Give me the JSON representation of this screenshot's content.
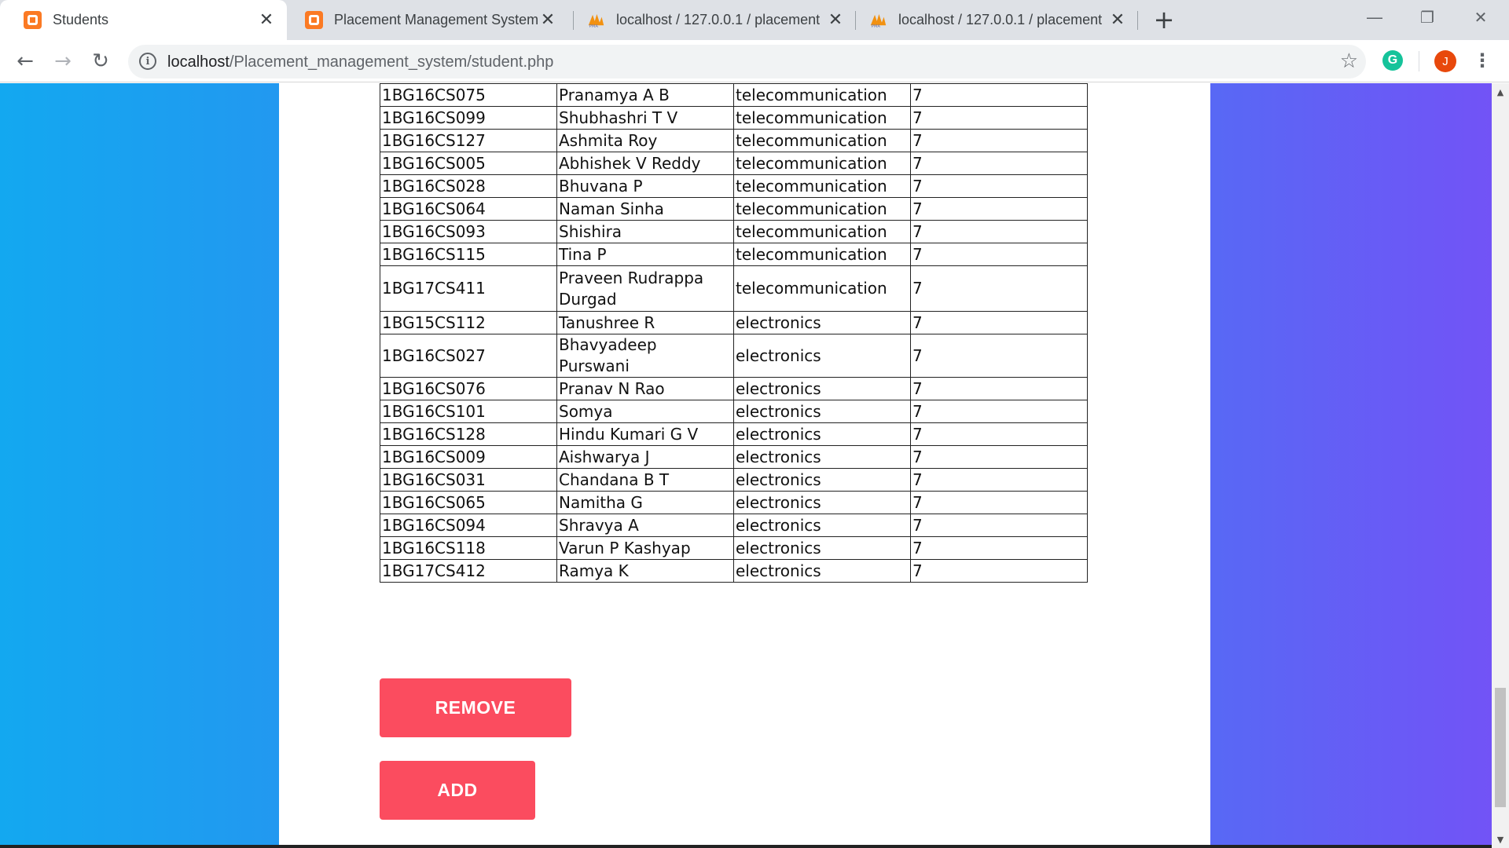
{
  "browser": {
    "tabs": [
      {
        "title": "Students",
        "icon": "xampp-icon",
        "active": true
      },
      {
        "title": "Placement Management System",
        "icon": "xampp-icon",
        "active": false
      },
      {
        "title": "localhost / 127.0.0.1 / placement",
        "icon": "phpmyadmin-icon",
        "active": false
      },
      {
        "title": "localhost / 127.0.0.1 / placement",
        "icon": "phpmyadmin-icon",
        "active": false
      }
    ],
    "url_host": "localhost",
    "url_path": "/Placement_management_system/student.php",
    "avatar_letter": "J",
    "extension_letter": "G"
  },
  "table": {
    "rows": [
      [
        "1BG16CS075",
        "Pranamya A B",
        "telecommunication",
        "7"
      ],
      [
        "1BG16CS099",
        "Shubhashri T V",
        "telecommunication",
        "7"
      ],
      [
        "1BG16CS127",
        "Ashmita Roy",
        "telecommunication",
        "7"
      ],
      [
        "1BG16CS005",
        "Abhishek V Reddy",
        "telecommunication",
        "7"
      ],
      [
        "1BG16CS028",
        "Bhuvana P",
        "telecommunication",
        "7"
      ],
      [
        "1BG16CS064",
        "Naman Sinha",
        "telecommunication",
        "7"
      ],
      [
        "1BG16CS093",
        "Shishira",
        "telecommunication",
        "7"
      ],
      [
        "1BG16CS115",
        "Tina P",
        "telecommunication",
        "7"
      ],
      [
        "1BG17CS411",
        "Praveen Rudrappa Durgad",
        "telecommunication",
        "7"
      ],
      [
        "1BG15CS112",
        "Tanushree R",
        "electronics",
        "7"
      ],
      [
        "1BG16CS027",
        "Bhavyadeep Purswani",
        "electronics",
        "7"
      ],
      [
        "1BG16CS076",
        "Pranav N Rao",
        "electronics",
        "7"
      ],
      [
        "1BG16CS101",
        "Somya",
        "electronics",
        "7"
      ],
      [
        "1BG16CS128",
        "Hindu Kumari G V",
        "electronics",
        "7"
      ],
      [
        "1BG16CS009",
        "Aishwarya J",
        "electronics",
        "7"
      ],
      [
        "1BG16CS031",
        "Chandana B T",
        "electronics",
        "7"
      ],
      [
        "1BG16CS065",
        "Namitha G",
        "electronics",
        "7"
      ],
      [
        "1BG16CS094",
        "Shravya A",
        "electronics",
        "7"
      ],
      [
        "1BG16CS118",
        "Varun P Kashyap",
        "electronics",
        "7"
      ],
      [
        "1BG17CS412",
        "Ramya K",
        "electronics",
        "7"
      ]
    ]
  },
  "actions": {
    "remove_label": "REMOVE",
    "add_label": "ADD"
  },
  "colors": {
    "button_bg": "#fb4c5f",
    "gradient_left": "#13a8f0",
    "gradient_right": "#7253f6"
  }
}
